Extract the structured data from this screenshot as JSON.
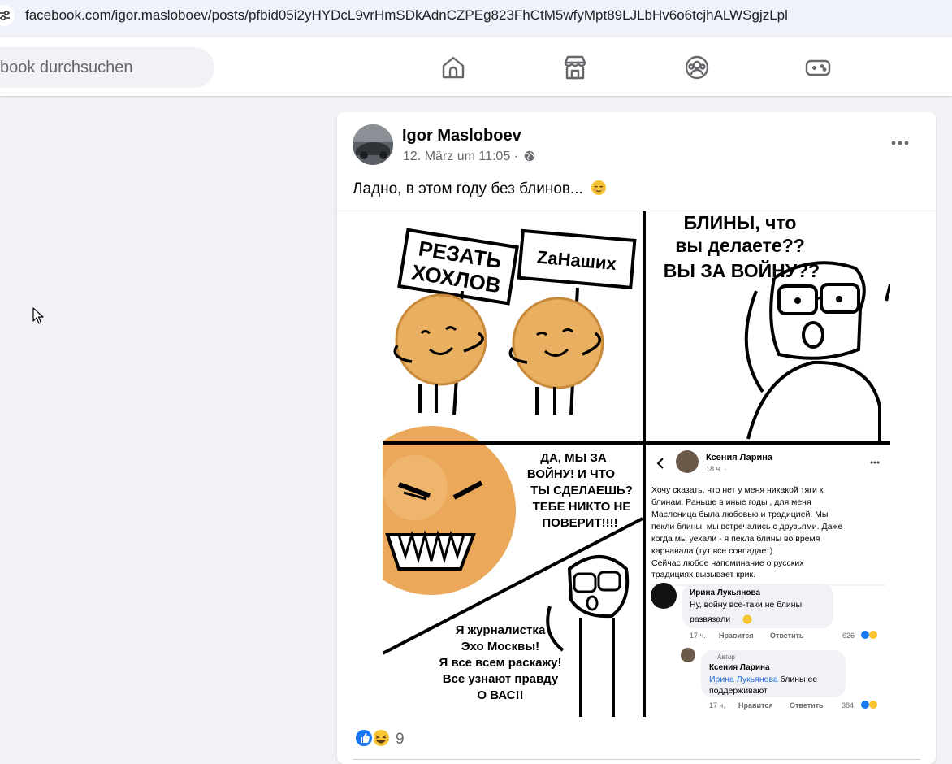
{
  "browser": {
    "url": "facebook.com/igor.masloboev/posts/pfbid05i2yHYDcL9vrHmSDkAdnCZPEg823FhCtM5wfyMpt89LJLbHv6o6tcjhALWSgjzLpl"
  },
  "topnav": {
    "search_placeholder": "book durchsuchen",
    "icons": [
      "home-icon",
      "marketplace-icon",
      "groups-icon",
      "gaming-icon"
    ]
  },
  "post": {
    "author": "Igor Masloboev",
    "date": "12. März um 11:05 ·",
    "text": "Ладно, в этом году без блинов...",
    "reaction_count": "9",
    "meme": {
      "panel1": {
        "sign1_line1": "РЕЗАТЬ",
        "sign1_line2": "ХОХЛОВ",
        "sign2": "ZaНаших"
      },
      "panel2": {
        "line1": "БЛИНЫ, что",
        "line2": "вы делаете??",
        "line3": "ВЫ ЗА ВОЙНУ??"
      },
      "panel3": {
        "top": [
          "ДА, МЫ ЗА",
          "ВОЙНУ! И ЧТО",
          "ТЫ СДЕЛАЕШЬ?",
          "ТЕБЕ НИКТО НЕ",
          "ПОВЕРИТ!!!!"
        ],
        "bottom": [
          "Я журналистка",
          "Эхо Москвы!",
          "Я все всем раскажу!",
          "Все узнают правду",
          "О ВАС!!"
        ]
      },
      "panel4": {
        "name": "Ксения Ларина",
        "time": "18 ч. ·",
        "body": [
          "Хочу сказать, что нет у меня никакой тяги к",
          "блинам. Раньше в иные годы , для меня",
          "Масленица была любовью и традицией.  Мы",
          "пекли блины, мы встречались с друзьями. Даже",
          "когда мы уехали - я пекла блины во время",
          "карнавала (тут все совпадает).",
          "Сейчас любое напоминание о русских",
          "традициях вызывает крик."
        ],
        "c1_name": "Ирина Лукьянова",
        "c1_line1": "Ну, войну все-таки не блины",
        "c1_line2": "развязали",
        "c1_time": "17 ч.",
        "c1_like": "Нравится",
        "c1_reply": "Ответить",
        "c1_count": "626",
        "c2_badge": "Автор",
        "c2_name": "Ксения Ларина",
        "c2_mention": "Ирина Лукьянова",
        "c2_rest": " блины ее",
        "c2_line2": "поддерживают",
        "c2_time": "17 ч.",
        "c2_like": "Нравится",
        "c2_reply": "Ответить",
        "c2_count": "384"
      }
    }
  }
}
